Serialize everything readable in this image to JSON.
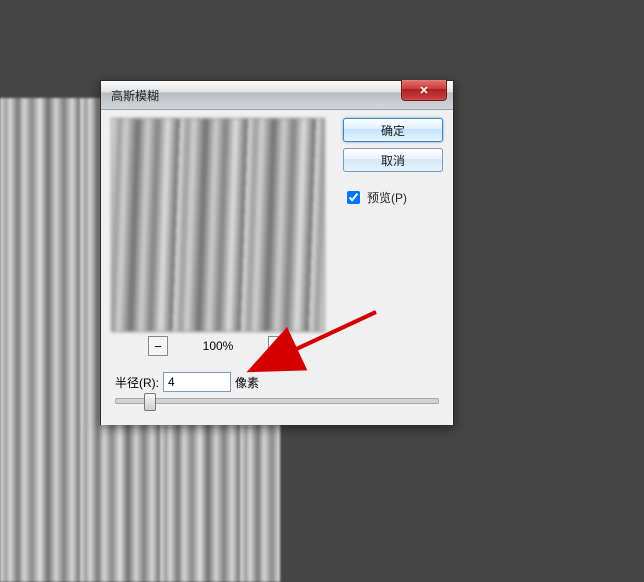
{
  "dialog": {
    "title": "高斯模糊",
    "ok_label": "确定",
    "cancel_label": "取消",
    "preview_label": "预览(P)",
    "preview_checked": true,
    "zoom_level": "100%",
    "radius_label": "半径(R):",
    "radius_value": "4",
    "radius_unit": "像素",
    "close_glyph": "✕",
    "minus_glyph": "−",
    "plus_glyph": "+"
  }
}
